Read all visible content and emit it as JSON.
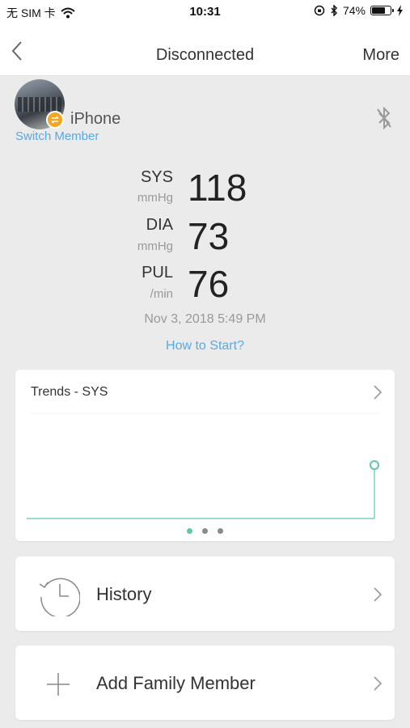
{
  "status_bar": {
    "carrier": "无 SIM 卡",
    "time": "10:31",
    "battery_text": "74%",
    "battery_level": 0.74
  },
  "nav": {
    "title": "Disconnected",
    "more_label": "More",
    "back_icon": "chevron-left-icon"
  },
  "member": {
    "name": "iPhone",
    "switch_label": "Switch Member",
    "bluetooth_state": "off"
  },
  "reading": {
    "sys_label": "SYS",
    "sys_unit": "mmHg",
    "sys_value": "118",
    "dia_label": "DIA",
    "dia_unit": "mmHg",
    "dia_value": "73",
    "pul_label": "PUL",
    "pul_unit": "/min",
    "pul_value": "76",
    "timestamp": "Nov 3, 2018 5:49 PM",
    "how_to_start": "How to Start?"
  },
  "trends": {
    "title": "Trends - SYS",
    "pages": 3,
    "active_page": 0
  },
  "menu": {
    "history_label": "History",
    "add_member_label": "Add Family Member"
  },
  "colors": {
    "accent_blue": "#58a9e6",
    "trend_green": "#5cc8a8",
    "badge_orange": "#f4a623"
  }
}
